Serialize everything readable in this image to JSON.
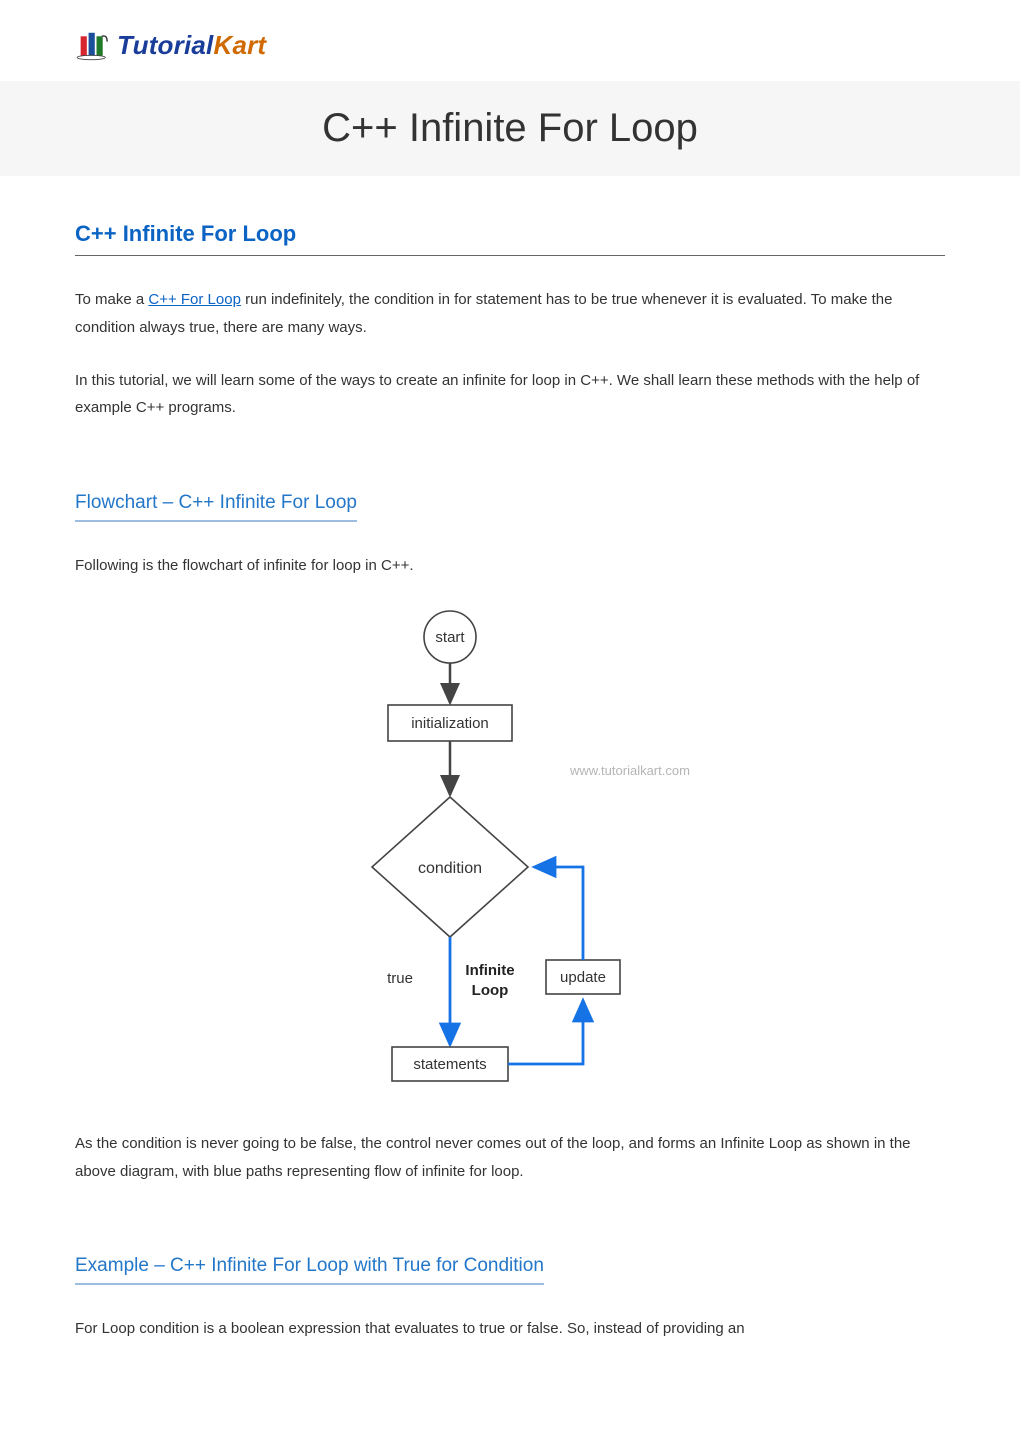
{
  "logo": {
    "tutorial": "Tutorial",
    "kart": "Kart"
  },
  "title": "C++ Infinite For Loop",
  "h2": "C++ Infinite For Loop",
  "p1_pre": "To make a ",
  "p1_link": "C++ For Loop",
  "p1_post": " run indefinitely, the condition in for statement has to be true whenever it is evaluated. To make the condition always true, there are many ways.",
  "p2": "In this tutorial, we will learn some of the ways to create an infinite for loop in C++. We shall learn these methods with the help of example C++ programs.",
  "h3a": "Flowchart – C++ Infinite For Loop",
  "p3": "Following is the flowchart of infinite for loop in C++.",
  "flow": {
    "start": "start",
    "init": "initialization",
    "watermark": "www.tutorialkart.com",
    "cond": "condition",
    "true": "true",
    "infinite1": "Infinite",
    "infinite2": "Loop",
    "update": "update",
    "stmts": "statements"
  },
  "p4": "As the condition is never going to be false, the control never comes out of the loop, and forms an Infinite Loop as shown in the above diagram, with blue paths representing flow of infinite for loop.",
  "h3b": "Example – C++ Infinite For Loop with True for Condition",
  "p5": "For Loop condition is a boolean expression that evaluates to true or false. So, instead of providing an"
}
